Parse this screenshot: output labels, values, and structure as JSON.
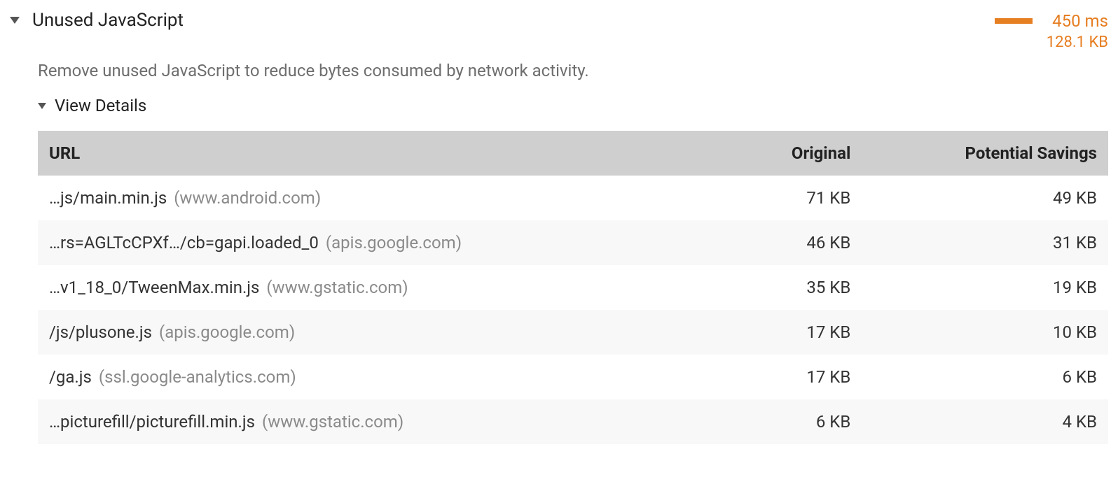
{
  "audit": {
    "title": "Unused JavaScript",
    "savings_time": "450 ms",
    "savings_size": "128.1 KB",
    "description": "Remove unused JavaScript to reduce bytes consumed by network activity.",
    "details_toggle": "View Details"
  },
  "columns": {
    "url": "URL",
    "original": "Original",
    "savings": "Potential Savings"
  },
  "rows": [
    {
      "path": "…js/main.min.js",
      "host": "(www.android.com)",
      "original": "71 KB",
      "savings": "49 KB"
    },
    {
      "path": "…rs=AGLTcCPXf…/cb=gapi.loaded_0",
      "host": "(apis.google.com)",
      "original": "46 KB",
      "savings": "31 KB"
    },
    {
      "path": "…v1_18_0/TweenMax.min.js",
      "host": "(www.gstatic.com)",
      "original": "35 KB",
      "savings": "19 KB"
    },
    {
      "path": "/js/plusone.js",
      "host": "(apis.google.com)",
      "original": "17 KB",
      "savings": "10 KB"
    },
    {
      "path": "/ga.js",
      "host": "(ssl.google-analytics.com)",
      "original": "17 KB",
      "savings": "6 KB"
    },
    {
      "path": "…picturefill/picturefill.min.js",
      "host": "(www.gstatic.com)",
      "original": "6 KB",
      "savings": "4 KB"
    }
  ]
}
